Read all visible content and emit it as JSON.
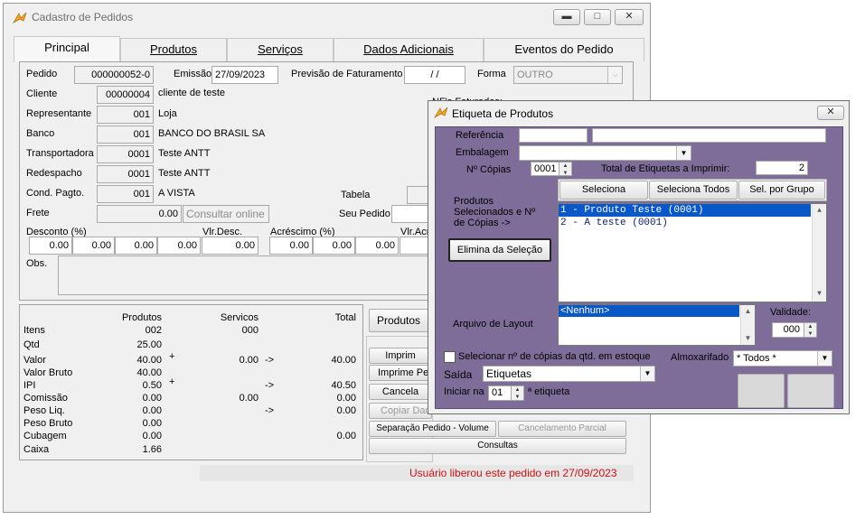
{
  "main_window": {
    "title": "Cadastro de Pedidos",
    "tabs": [
      "Principal",
      "Produtos",
      "Serviços",
      "Dados Adicionais",
      "Eventos do Pedido"
    ],
    "pedido": {
      "pedido_label": "Pedido",
      "pedido_value": "000000052-0",
      "emissao_label": "Emissão",
      "emissao_value": "27/09/2023",
      "previsao_label": "Previsão de Faturamento",
      "previsao_value": "/ /",
      "forma_label": "Forma",
      "forma_value": "OUTRO",
      "cliente_label": "Cliente",
      "cliente_code": "00000004",
      "cliente_name": "cliente de teste",
      "nfs_label": "NF's Faturados:",
      "representante_label": "Representante",
      "representante_code": "001",
      "representante_name": "Loja",
      "banco_label": "Banco",
      "banco_code": "001",
      "banco_name": "BANCO DO BRASIL SA",
      "transportadora_label": "Transportadora",
      "transportadora_code": "0001",
      "transportadora_name": "Teste ANTT",
      "redespacho_label": "Redespacho",
      "redespacho_code": "0001",
      "redespacho_name": "Teste ANTT",
      "cond_label": "Cond. Pagto.",
      "cond_code": "001",
      "cond_name": "A VISTA",
      "tabela_label": "Tabela",
      "frete_label": "Frete",
      "frete_value": "0.00",
      "consultar_label": "Consultar online",
      "seu_pedido_label": "Seu Pedido",
      "desconto_label": "Desconto (%)",
      "desconto_values": [
        "0.00",
        "0.00",
        "0.00",
        "0.00"
      ],
      "vlr_desc_label": "Vlr.Desc.",
      "vlr_desc_value": "0.00",
      "acrescimo_label": "Acréscimo (%)",
      "acrescimo_values": [
        "0.00",
        "0.00",
        "0.00"
      ],
      "vlr_acr_label": "Vlr.Acr",
      "obs_label": "Obs."
    },
    "summary": {
      "col_produtos": "Produtos",
      "col_servicos": "Servicos",
      "col_total": "Total",
      "rows": [
        {
          "label": "Itens",
          "produtos": "002",
          "servicos": "000",
          "total": ""
        },
        {
          "label": "Qtd",
          "produtos": "25.00",
          "servicos": "",
          "total": ""
        },
        {
          "label": "Valor",
          "produtos": "40.00",
          "servicos": "0.00",
          "total": "40.00"
        },
        {
          "label": "Valor Bruto",
          "produtos": "40.00",
          "servicos": "",
          "total": ""
        },
        {
          "label": "IPI",
          "produtos": "0.50",
          "servicos": "",
          "total": "40.50"
        },
        {
          "label": "Comissão",
          "produtos": "0.00",
          "servicos": "0.00",
          "total": "0.00"
        },
        {
          "label": "Peso Liq.",
          "produtos": "0.00",
          "servicos": "",
          "total": "0.00"
        },
        {
          "label": "Peso Bruto",
          "produtos": "0.00",
          "servicos": "",
          "total": ""
        },
        {
          "label": "Cubagem",
          "produtos": "0.00",
          "servicos": "",
          "total": "0.00"
        },
        {
          "label": "Caixa",
          "produtos": "1.66",
          "servicos": "",
          "total": ""
        }
      ],
      "plus": "+",
      "arrow": "->"
    },
    "actions": {
      "produtos_btn": "Produtos",
      "imprime_btn": "Imprim",
      "imprime_pedido_btn": "Imprime Pedid",
      "cancela_btn": "Cancela",
      "copiar_btn": "Copiar Dados",
      "separacao_btn": "Separação Pedido - Volume",
      "cancelamento_btn": "Cancelamento Parcial",
      "consultas_btn": "Consultas"
    },
    "status_text": "Usuário  liberou este pedido em 27/09/2023"
  },
  "dialog": {
    "title": "Etiqueta de Produtos",
    "referencia_label": "Referência",
    "embalagem_label": "Embalagem",
    "copias_label": "Nº Cópias",
    "copias_value": "0001",
    "total_label": "Total de Etiquetas a Imprimir:",
    "total_value": "2",
    "produtos_sel_label": "Produtos Selecionados e Nº de Cópias ->",
    "seleciona_btn": "Seleciona",
    "seleciona_todos_btn": "Seleciona Todos",
    "sel_grupo_btn": "Sel. por Grupo",
    "elimina_btn": "Elimina da Seleção",
    "selected_items": [
      "1 - Produto Teste (0001)",
      "2 - A teste (0001)"
    ],
    "arquivo_label": "Arquivo de Layout",
    "layout_items": [
      "<Nenhum>"
    ],
    "validade_label": "Validade:",
    "validade_value": "000",
    "selecionar_copias_label": "Selecionar nº de cópias da qtd. em estoque",
    "almoxarifado_label": "Almoxarifado",
    "almoxarifado_value": "* Todos *",
    "saida_label": "Saída",
    "saida_value": "Etiquetas",
    "iniciar_label": "Iniciar na",
    "iniciar_value": "01",
    "etiqueta_label": "ª etiqueta"
  },
  "colors": {
    "dialog_bg": "#7d6d98",
    "selection": "#0a58c8",
    "status_red": "#d01010"
  },
  "icons": [
    "app-logo-icon",
    "minimize-icon",
    "maximize-icon",
    "close-icon",
    "chevron-down-icon",
    "spin-icon",
    "scroll-arrow-icon"
  ]
}
